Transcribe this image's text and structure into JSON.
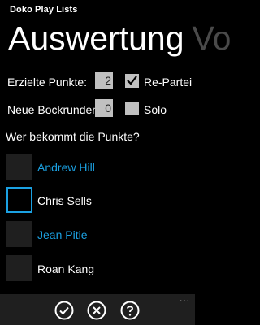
{
  "app": {
    "title": "Doko Play Lists"
  },
  "pivot": {
    "active": "Auswertung",
    "next": "Vo"
  },
  "form": {
    "points_label": "Erzielte Punkte:",
    "points_value": "2",
    "re_partei_label": "Re-Partei",
    "re_partei_checked": true,
    "bock_label": "Neue Bockrunden:",
    "bock_value": "0",
    "solo_label": "Solo",
    "solo_checked": false
  },
  "question": "Wer bekommt die Punkte?",
  "players": [
    {
      "name": "Andrew Hill",
      "highlighted": true,
      "selected": false
    },
    {
      "name": "Chris Sells",
      "highlighted": false,
      "selected": true
    },
    {
      "name": "Jean Pitie",
      "highlighted": true,
      "selected": false
    },
    {
      "name": "Roan Kang",
      "highlighted": false,
      "selected": false
    }
  ],
  "appbar": {
    "buttons": [
      {
        "icon": "check-icon"
      },
      {
        "icon": "cancel-icon"
      },
      {
        "icon": "help-icon"
      }
    ],
    "more": "..."
  },
  "colors": {
    "accent": "#1ba1e2",
    "background": "#000000",
    "control": "#c0c0c0",
    "appbar": "#1f1f1f"
  }
}
